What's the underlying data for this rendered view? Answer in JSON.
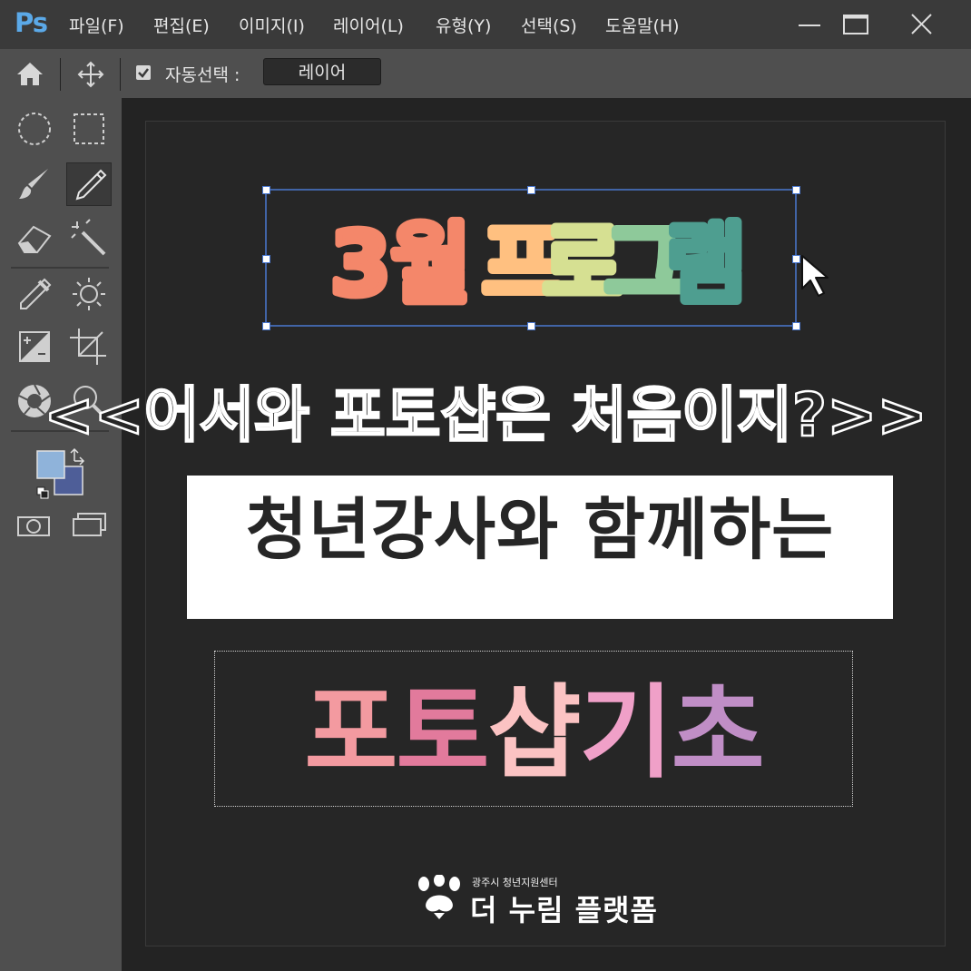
{
  "app": {
    "logo": "Ps"
  },
  "menu": [
    "파일(F)",
    "편집(E)",
    "이미지(I)",
    "레이어(L)",
    "유형(Y)",
    "선택(S)",
    "도움말(H)"
  ],
  "window_controls": {
    "minimize": "minimize-icon",
    "maximize": "maximize-icon",
    "close": "close-icon"
  },
  "options_bar": {
    "auto_select_label": "자동선택 :",
    "auto_select_checked": true,
    "select_value": "레이어"
  },
  "tools": [
    "ellipse-marquee-icon",
    "rect-marquee-icon",
    "brush-icon",
    "pencil-icon",
    "eraser-icon",
    "magic-wand-icon",
    "eyedropper-icon",
    "brightness-icon",
    "exposure-icon",
    "crop-icon",
    "aperture-icon",
    "zoom-icon",
    "color-swatches-icon",
    "quick-mask-icon",
    "screen-mode-icon"
  ],
  "colors": {
    "foreground": "#8fb3da",
    "background": "#4e5e98",
    "selection": "#4a78d0",
    "accent": "#5ba9e8"
  },
  "canvas": {
    "title_chars": [
      {
        "text": "3월",
        "color": "#f4876a"
      },
      {
        "text": "프",
        "color": "#ffc080"
      },
      {
        "text": "로",
        "color": "#d6e092"
      },
      {
        "text": "그",
        "color": "#8ec99a"
      },
      {
        "text": "램",
        "color": "#4e9e90"
      }
    ],
    "headline": "<<어서와 포토샵은 처음이지?>>",
    "subtitle": "청년강사와 함께하는",
    "main_title_chars": [
      {
        "text": "포",
        "color": "#f39aa0"
      },
      {
        "text": "토",
        "color": "#e27a9c"
      },
      {
        "text": "샵",
        "color": "#fbc3c3"
      },
      {
        "text": "기",
        "color": "#f0a0c8"
      },
      {
        "text": "초",
        "color": "#c08ec6"
      }
    ],
    "org_small": "광주시 청년지원센터",
    "org_name": "더 누림 플랫폼"
  }
}
